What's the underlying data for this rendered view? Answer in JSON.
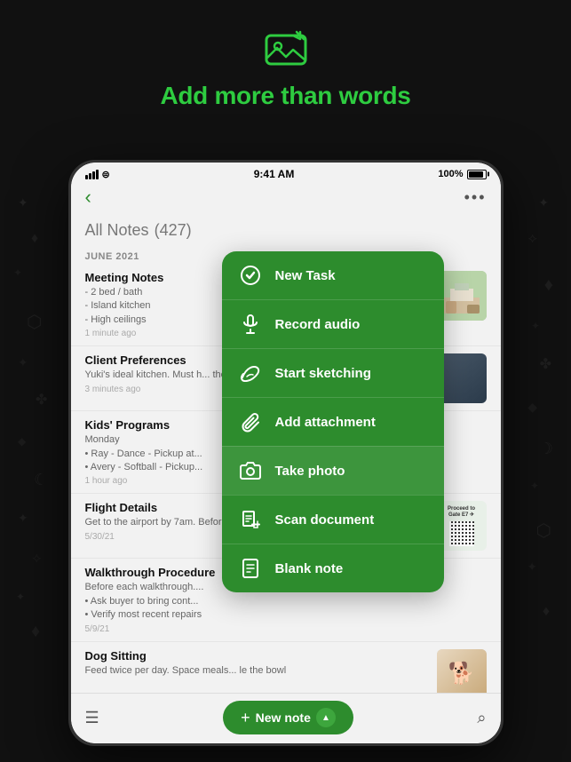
{
  "hero": {
    "title_prefix": "Add ",
    "title_highlight": "more than words",
    "icon_alt": "image-icon"
  },
  "status_bar": {
    "signal": "●●●",
    "wifi": "wifi",
    "time": "9:41 AM",
    "battery": "100%"
  },
  "nav": {
    "back_icon": "‹",
    "more_icon": "•••"
  },
  "notes_header": {
    "title": "All Notes",
    "count": "(427)"
  },
  "section_label": "JUNE 2021",
  "notes": [
    {
      "title": "Meeting Notes",
      "body": "- 2 bed / bath\n- Island kitchen\n- High ceilings",
      "time": "1 minute ago",
      "has_thumb": true,
      "thumb_type": "room"
    },
    {
      "title": "Client Preferences",
      "body": "Yuki's ideal kitchen. Must h... the more natu...",
      "time": "3 minutes ago",
      "has_thumb": true,
      "thumb_type": "dark"
    },
    {
      "title": "Kids' Programs",
      "body": "Monday\n• Ray - Dance - Pickup at...\n• Avery - Softball - Pickup...",
      "time": "1 hour ago",
      "has_thumb": false
    },
    {
      "title": "Flight Details",
      "body": "Get to the airport by 7am. Before takeoff, check traffic... dinner suggestion...",
      "time": "5/30/21",
      "has_thumb": true,
      "thumb_type": "boarding"
    },
    {
      "title": "Walkthrough Procedure",
      "body": "Before each walkthrough....\n• Ask buyer to bring cont...\n• Verify most recent repairs",
      "time": "5/9/21",
      "has_thumb": false
    },
    {
      "title": "Dog Sitting",
      "body": "Feed twice per day. Space meals... le the bowl",
      "time": "",
      "has_thumb": true,
      "thumb_type": "dog"
    }
  ],
  "action_menu": {
    "items": [
      {
        "id": "new-task",
        "label": "New Task",
        "icon": "✓"
      },
      {
        "id": "record-audio",
        "label": "Record audio",
        "icon": "🎤"
      },
      {
        "id": "start-sketching",
        "label": "Start sketching",
        "icon": "✏️"
      },
      {
        "id": "add-attachment",
        "label": "Add attachment",
        "icon": "📎"
      },
      {
        "id": "take-photo",
        "label": "Take photo",
        "icon": "📷"
      },
      {
        "id": "scan-document",
        "label": "Scan document",
        "icon": "📄"
      },
      {
        "id": "blank-note",
        "label": "Blank note",
        "icon": "📝"
      }
    ]
  },
  "bottom_bar": {
    "new_note_label": "New note",
    "new_note_plus": "+",
    "search_icon": "🔍"
  }
}
